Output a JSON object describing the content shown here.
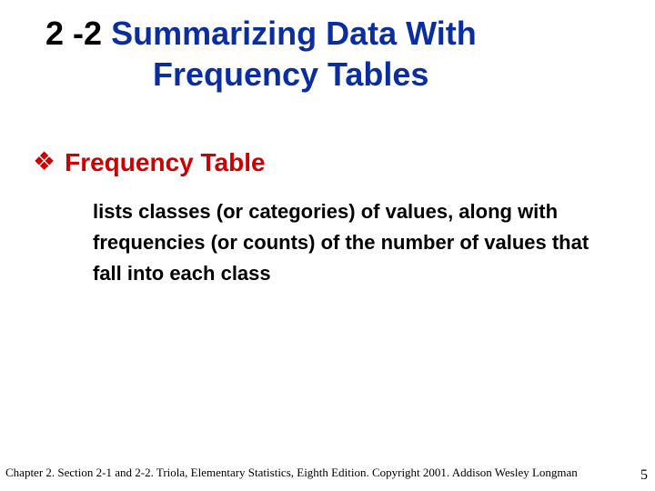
{
  "title": {
    "section_number": "2 -2",
    "section_name_line1": "Summarizing Data With",
    "section_name_line2": "Frequency Tables"
  },
  "bullet": {
    "icon": "❖",
    "heading": "Frequency Table"
  },
  "body": {
    "text": "lists classes (or categories) of values, along with frequencies (or counts) of the number of values that fall into each class"
  },
  "footer": {
    "text": "Chapter 2.  Section 2-1 and 2-2. Triola, Elementary Statistics, Eighth Edition. Copyright 2001.  Addison Wesley Longman"
  },
  "page_number": "5"
}
